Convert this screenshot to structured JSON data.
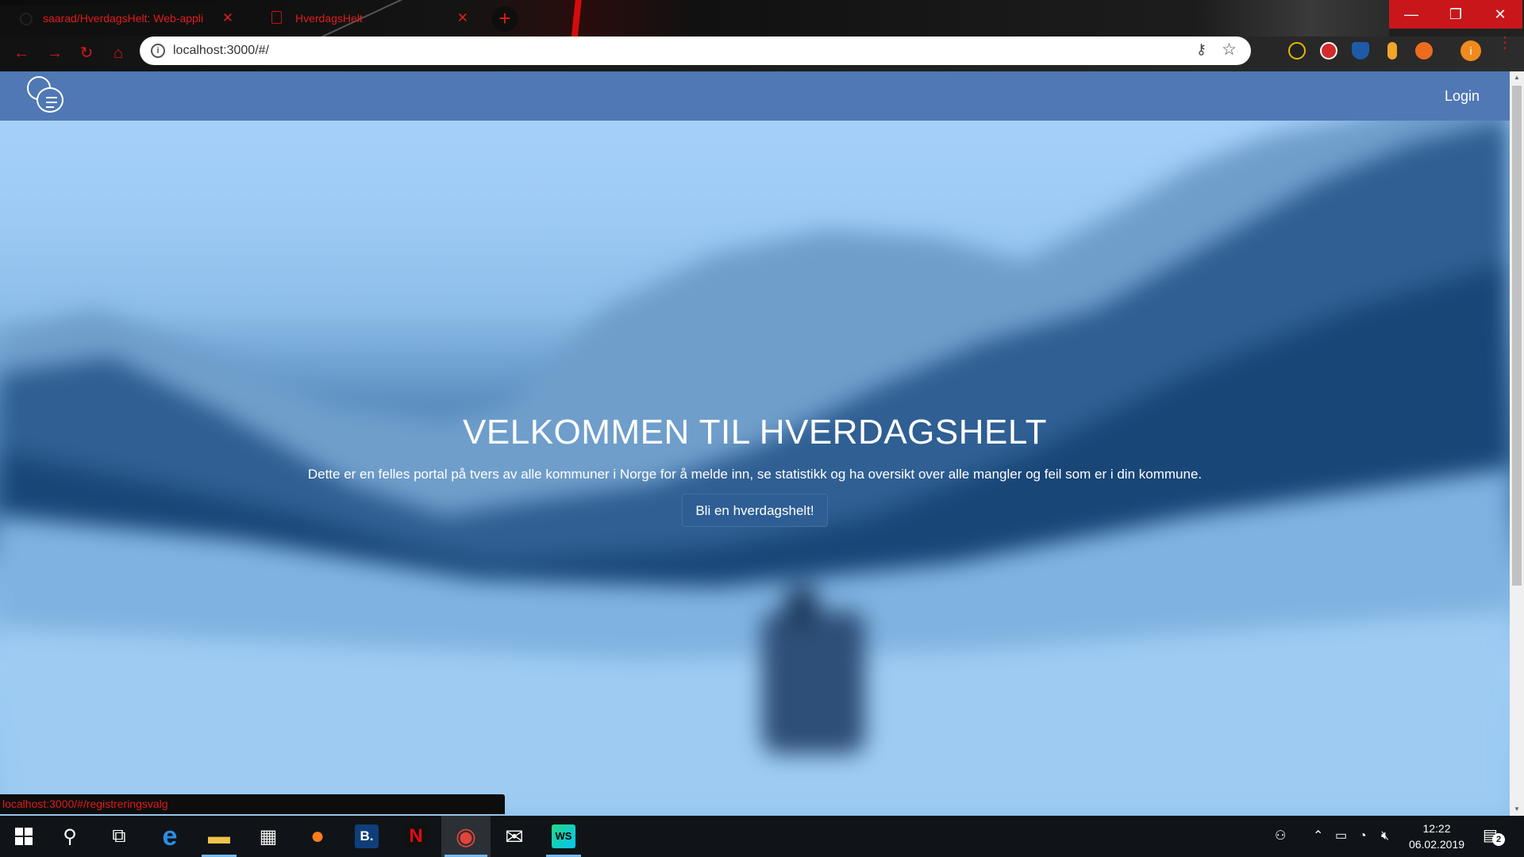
{
  "browser": {
    "tabs": [
      {
        "title": "saarad/HverdagsHelt: Web-appli",
        "close": "✕"
      },
      {
        "title": "HverdagsHelt",
        "close": "✕"
      }
    ],
    "new_tab": "+",
    "window_controls": {
      "minimize": "—",
      "maximize": "❐",
      "close": "✕"
    },
    "nav": {
      "back": "←",
      "forward": "→",
      "reload": "↻",
      "home": "⌂"
    },
    "address": {
      "info": "i",
      "url": "localhost:3000/#/"
    },
    "omnibox_icons": {
      "key": "⚷",
      "star": "☆"
    },
    "profile": "i",
    "menu": "⋮",
    "status_url": "localhost:3000/#/registreringsvalg",
    "accent_color": "#e21b1b"
  },
  "site": {
    "nav": {
      "login": "Login",
      "bg_color": "#4f78b5"
    },
    "hero": {
      "title": "VELKOMMEN TIL HVERDAGSHELT",
      "text": "Dette er en felles portal på tvers av alle kommuner i Norge for å melde inn, se statistikk og ha oversikt over alle mangler og feil som er i din kommune.",
      "button": "Bli en hverdagshelt!"
    }
  },
  "scrollbar": {
    "up": "▲",
    "down": "▼"
  },
  "taskbar": {
    "items": [
      {
        "name": "start-button",
        "icon": "windows-icon"
      },
      {
        "name": "search-button",
        "icon": "search-icon",
        "glyph": "⚲"
      },
      {
        "name": "task-view-button",
        "icon": "task-view-icon",
        "glyph": "⧉"
      },
      {
        "name": "edge-button",
        "icon": "edge-icon",
        "glyph": "e"
      },
      {
        "name": "file-explorer-button",
        "icon": "folder-icon",
        "glyph": "▬"
      },
      {
        "name": "store-button",
        "icon": "store-icon",
        "glyph": "▦"
      },
      {
        "name": "firefox-button",
        "icon": "firefox-icon",
        "glyph": "●"
      },
      {
        "name": "booking-button",
        "icon": "booking-icon",
        "glyph": "B."
      },
      {
        "name": "netflix-button",
        "icon": "netflix-icon",
        "glyph": "N"
      },
      {
        "name": "chrome-button",
        "icon": "chrome-icon",
        "glyph": "◉"
      },
      {
        "name": "mail-button",
        "icon": "mail-icon",
        "glyph": "✉"
      },
      {
        "name": "webstorm-button",
        "icon": "webstorm-icon",
        "glyph": "WS"
      }
    ],
    "tray": {
      "people": "⚇",
      "chevron": "⌃",
      "battery": "▭",
      "wifi": "◔",
      "volume": "🔇︎"
    },
    "clock": {
      "time": "12:22",
      "date": "06.02.2019"
    },
    "notifications": {
      "glyph": "▤",
      "count": "2"
    }
  }
}
